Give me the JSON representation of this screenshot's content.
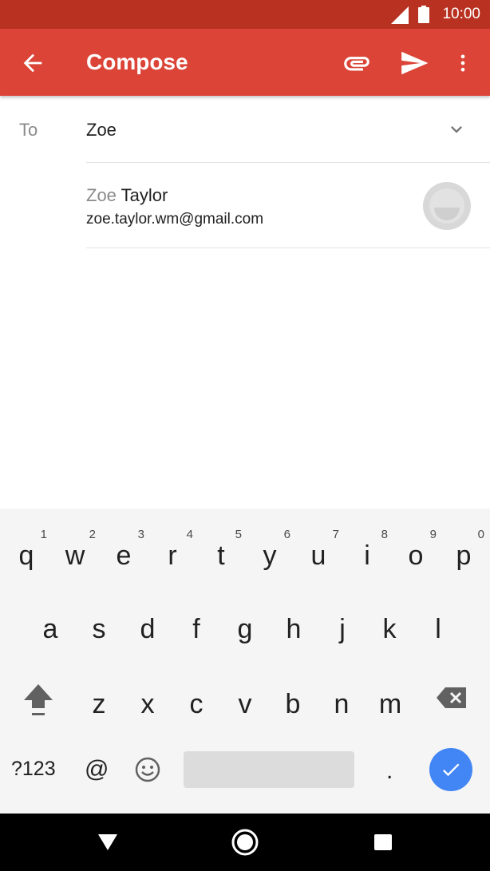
{
  "status_bar": {
    "time": "10:00",
    "icons": [
      "signal-icon",
      "battery-icon"
    ]
  },
  "app_bar": {
    "title": "Compose",
    "icons": [
      "back-arrow-icon",
      "attachment-icon",
      "send-icon",
      "more-vert-icon"
    ]
  },
  "to_row": {
    "label": "To",
    "value": "Zoe"
  },
  "suggestion": {
    "name_match": "Zoe",
    "name_rest": " Taylor",
    "email": "zoe.taylor.wm@gmail.com"
  },
  "keyboard": {
    "row1": [
      {
        "ch": "q",
        "hint": "1"
      },
      {
        "ch": "w",
        "hint": "2"
      },
      {
        "ch": "e",
        "hint": "3"
      },
      {
        "ch": "r",
        "hint": "4"
      },
      {
        "ch": "t",
        "hint": "5"
      },
      {
        "ch": "y",
        "hint": "6"
      },
      {
        "ch": "u",
        "hint": "7"
      },
      {
        "ch": "i",
        "hint": "8"
      },
      {
        "ch": "o",
        "hint": "9"
      },
      {
        "ch": "p",
        "hint": "0"
      }
    ],
    "row2": [
      "a",
      "s",
      "d",
      "f",
      "g",
      "h",
      "j",
      "k",
      "l"
    ],
    "row3": [
      "z",
      "x",
      "c",
      "v",
      "b",
      "n",
      "m"
    ],
    "symbols_label": "?123",
    "at_label": "@",
    "period_label": ".",
    "accent_color": "#4285f4"
  },
  "colors": {
    "app_bar": "#db4437",
    "status_bar": "#b93221"
  }
}
